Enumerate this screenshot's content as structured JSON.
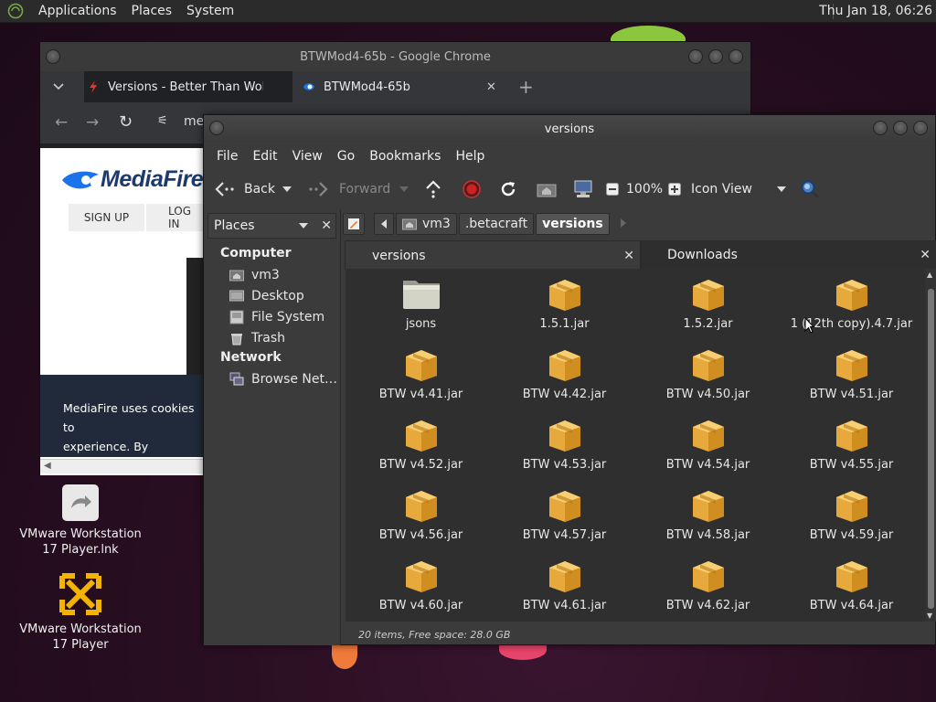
{
  "panel": {
    "menus": [
      "Applications",
      "Places",
      "System"
    ],
    "clock": "Thu Jan 18, 06:26"
  },
  "desktop": {
    "icons": [
      {
        "label_line1": "VMware Workstation",
        "label_line2": "17 Player.lnk",
        "icon": "shortcut-icon"
      },
      {
        "label_line1": "VMware Workstation",
        "label_line2": "17 Player",
        "icon": "vmware-icon"
      }
    ]
  },
  "chrome": {
    "title": "BTWMod4-65b - Google Chrome",
    "tabs": [
      {
        "label": "Versions - Better Than Wolve",
        "icon": "lightning-favicon-icon"
      },
      {
        "label": "BTWMod4-65b",
        "icon": "mediafire-favicon-icon"
      }
    ],
    "new_tab": "+",
    "address_partial": "me",
    "page": {
      "logo": "MediaFire",
      "sign_up": "SIGN UP",
      "log_in": "LOG IN",
      "cookie_line1": "MediaFire uses cookies to",
      "cookie_line2": "experience. By continuing"
    }
  },
  "caja": {
    "title": "versions",
    "menu": [
      "File",
      "Edit",
      "View",
      "Go",
      "Bookmarks",
      "Help"
    ],
    "toolbar": {
      "back": "Back",
      "forward": "Forward",
      "zoom": "100%",
      "view_mode": "Icon View"
    },
    "sidebar": {
      "header": "Places",
      "sections": [
        {
          "title": "Computer",
          "items": [
            {
              "label": "vm3",
              "icon": "home-folder-icon"
            },
            {
              "label": "Desktop",
              "icon": "desktop-icon"
            },
            {
              "label": "File System",
              "icon": "drive-icon"
            },
            {
              "label": "Trash",
              "icon": "trash-icon"
            }
          ]
        },
        {
          "title": "Network",
          "items": [
            {
              "label": "Browse Net…",
              "icon": "network-icon"
            }
          ]
        }
      ]
    },
    "path": [
      "vm3",
      ".betacraft",
      "versions"
    ],
    "tabs": [
      {
        "label": "versions",
        "active": true
      },
      {
        "label": "Downloads",
        "active": false
      }
    ],
    "files": [
      {
        "name": "jsons",
        "type": "folder"
      },
      {
        "name": "1.5.1.jar",
        "type": "jar"
      },
      {
        "name": "1.5.2.jar",
        "type": "jar"
      },
      {
        "name": "1 (12th copy).4.7.jar",
        "type": "jar"
      },
      {
        "name": "BTW v4.41.jar",
        "type": "jar"
      },
      {
        "name": "BTW v4.42.jar",
        "type": "jar"
      },
      {
        "name": "BTW v4.50.jar",
        "type": "jar"
      },
      {
        "name": "BTW v4.51.jar",
        "type": "jar"
      },
      {
        "name": "BTW v4.52.jar",
        "type": "jar"
      },
      {
        "name": "BTW v4.53.jar",
        "type": "jar"
      },
      {
        "name": "BTW v4.54.jar",
        "type": "jar"
      },
      {
        "name": "BTW v4.55.jar",
        "type": "jar"
      },
      {
        "name": "BTW v4.56.jar",
        "type": "jar"
      },
      {
        "name": "BTW v4.57.jar",
        "type": "jar"
      },
      {
        "name": "BTW v4.58.jar",
        "type": "jar"
      },
      {
        "name": "BTW v4.59.jar",
        "type": "jar"
      },
      {
        "name": "BTW v4.60.jar",
        "type": "jar"
      },
      {
        "name": "BTW v4.61.jar",
        "type": "jar"
      },
      {
        "name": "BTW v4.62.jar",
        "type": "jar"
      },
      {
        "name": "BTW v4.64.jar",
        "type": "jar"
      }
    ],
    "status": "20 items, Free space: 28.0 GB"
  }
}
